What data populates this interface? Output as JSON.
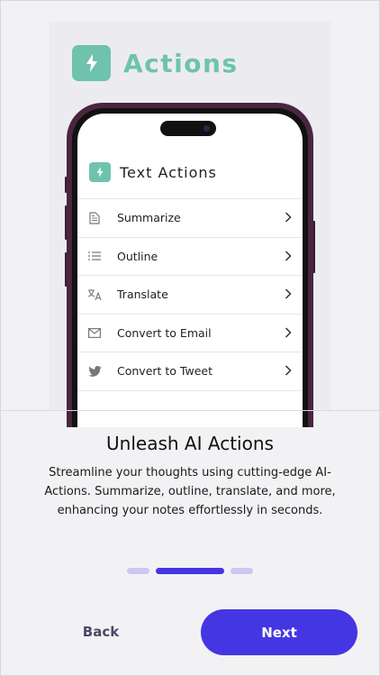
{
  "brand": {
    "title": "Actions",
    "icon": "lightning-bolt-icon",
    "accent": "#6fc3ad"
  },
  "phone_screen": {
    "title": "Text Actions",
    "icon": "lightning-bolt-icon",
    "actions": [
      {
        "label": "Summarize",
        "icon": "document-icon"
      },
      {
        "label": "Outline",
        "icon": "list-icon"
      },
      {
        "label": "Translate",
        "icon": "translate-icon"
      },
      {
        "label": "Convert to Email",
        "icon": "mail-icon"
      },
      {
        "label": "Convert to Tweet",
        "icon": "twitter-bird-icon"
      }
    ]
  },
  "onboarding": {
    "headline": "Unleash AI Actions",
    "body": "Streamline your thoughts using cutting-edge AI-Actions. Summarize, outline, translate, and more, enhancing your notes effortlessly in seconds.",
    "page_indicator": {
      "total": 3,
      "active": 2
    }
  },
  "buttons": {
    "back": "Back",
    "next": "Next"
  },
  "colors": {
    "primary": "#4536e3",
    "dot_inactive": "#cbc7f2",
    "background": "#f2f2f5"
  }
}
